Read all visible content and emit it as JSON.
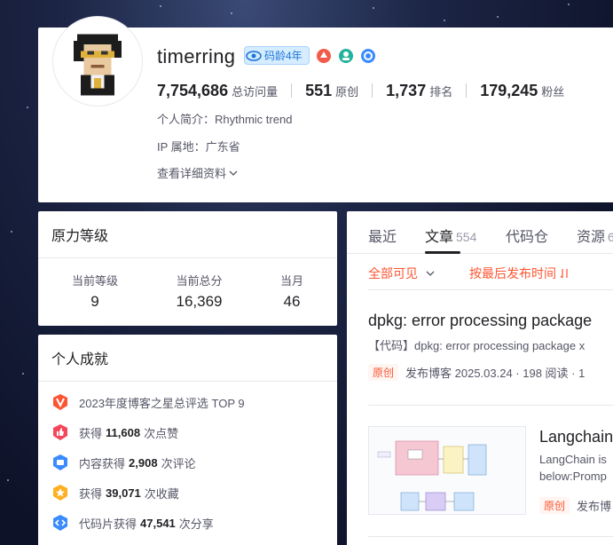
{
  "profile": {
    "username": "timerring",
    "code_age_badge": "码龄4年",
    "stats": [
      {
        "value": "7,754,686",
        "label": "总访问量"
      },
      {
        "value": "551",
        "label": "原创"
      },
      {
        "value": "1,737",
        "label": "排名"
      },
      {
        "value": "179,245",
        "label": "粉丝"
      }
    ],
    "bio": "个人简介：Rhythmic trend",
    "ip": "IP 属地：广东省",
    "details_link": "查看详细资料"
  },
  "level": {
    "title": "原力等级",
    "columns": [
      {
        "label": "当前等级",
        "value": "9"
      },
      {
        "label": "当前总分",
        "value": "16,369"
      },
      {
        "label": "当月",
        "value": "46"
      }
    ]
  },
  "achievements": {
    "title": "个人成就",
    "items": [
      {
        "pre": "2023年度博客之星总评选 TOP 9",
        "num": "",
        "post": "",
        "icon": "v-badge-icon",
        "color": "#fc5531"
      },
      {
        "pre": "获得",
        "num": "11,608",
        "post": "次点赞",
        "icon": "thumbs-up-icon",
        "color": "#f5475b"
      },
      {
        "pre": "内容获得",
        "num": "2,908",
        "post": "次评论",
        "icon": "comment-icon",
        "color": "#3a8bff"
      },
      {
        "pre": "获得",
        "num": "39,071",
        "post": "次收藏",
        "icon": "star-icon",
        "color": "#ffb020"
      },
      {
        "pre": "代码片获得",
        "num": "47,541",
        "post": "次分享",
        "icon": "code-icon",
        "color": "#3a8bff"
      }
    ]
  },
  "tabs": [
    {
      "label": "最近",
      "count": ""
    },
    {
      "label": "文章",
      "count": "554"
    },
    {
      "label": "代码仓",
      "count": ""
    },
    {
      "label": "资源",
      "count": "6"
    }
  ],
  "filters": {
    "visibility": "全部可见",
    "sort": "按最后发布时间"
  },
  "articles": [
    {
      "title": "dpkg: error processing package",
      "desc": "【代码】dpkg: error processing package x",
      "tag": "原创",
      "meta": "发布博客 2025.03.24 · 198 阅读 · 1"
    },
    {
      "title": "Langchain",
      "desc1": "LangChain is",
      "desc2": "below:Promp",
      "tag": "原创",
      "meta": "发布博"
    }
  ],
  "colors": {
    "accent": "#fc5531",
    "badge_blue": "#1e77d6",
    "background": "#141b33"
  }
}
